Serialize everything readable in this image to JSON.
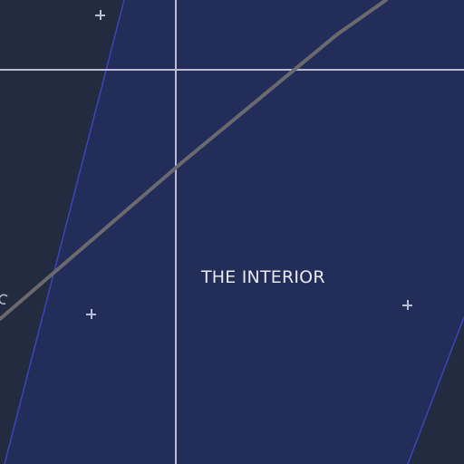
{
  "map": {
    "region_label": "THE INTERIOR",
    "colors": {
      "background": "#222b40",
      "region_fill": "#232d5a",
      "region_border": "#3c44b8",
      "grid_line": "#bcbcd4",
      "route_line": "#6a6a6e",
      "marker": "#b9bfd6",
      "label": "#e8eaf2"
    },
    "markers": [
      {
        "name": "location-marker-1",
        "icon": "plus-icon"
      },
      {
        "name": "location-marker-2",
        "icon": "plus-icon"
      },
      {
        "name": "location-marker-3",
        "icon": "plus-icon"
      }
    ]
  }
}
